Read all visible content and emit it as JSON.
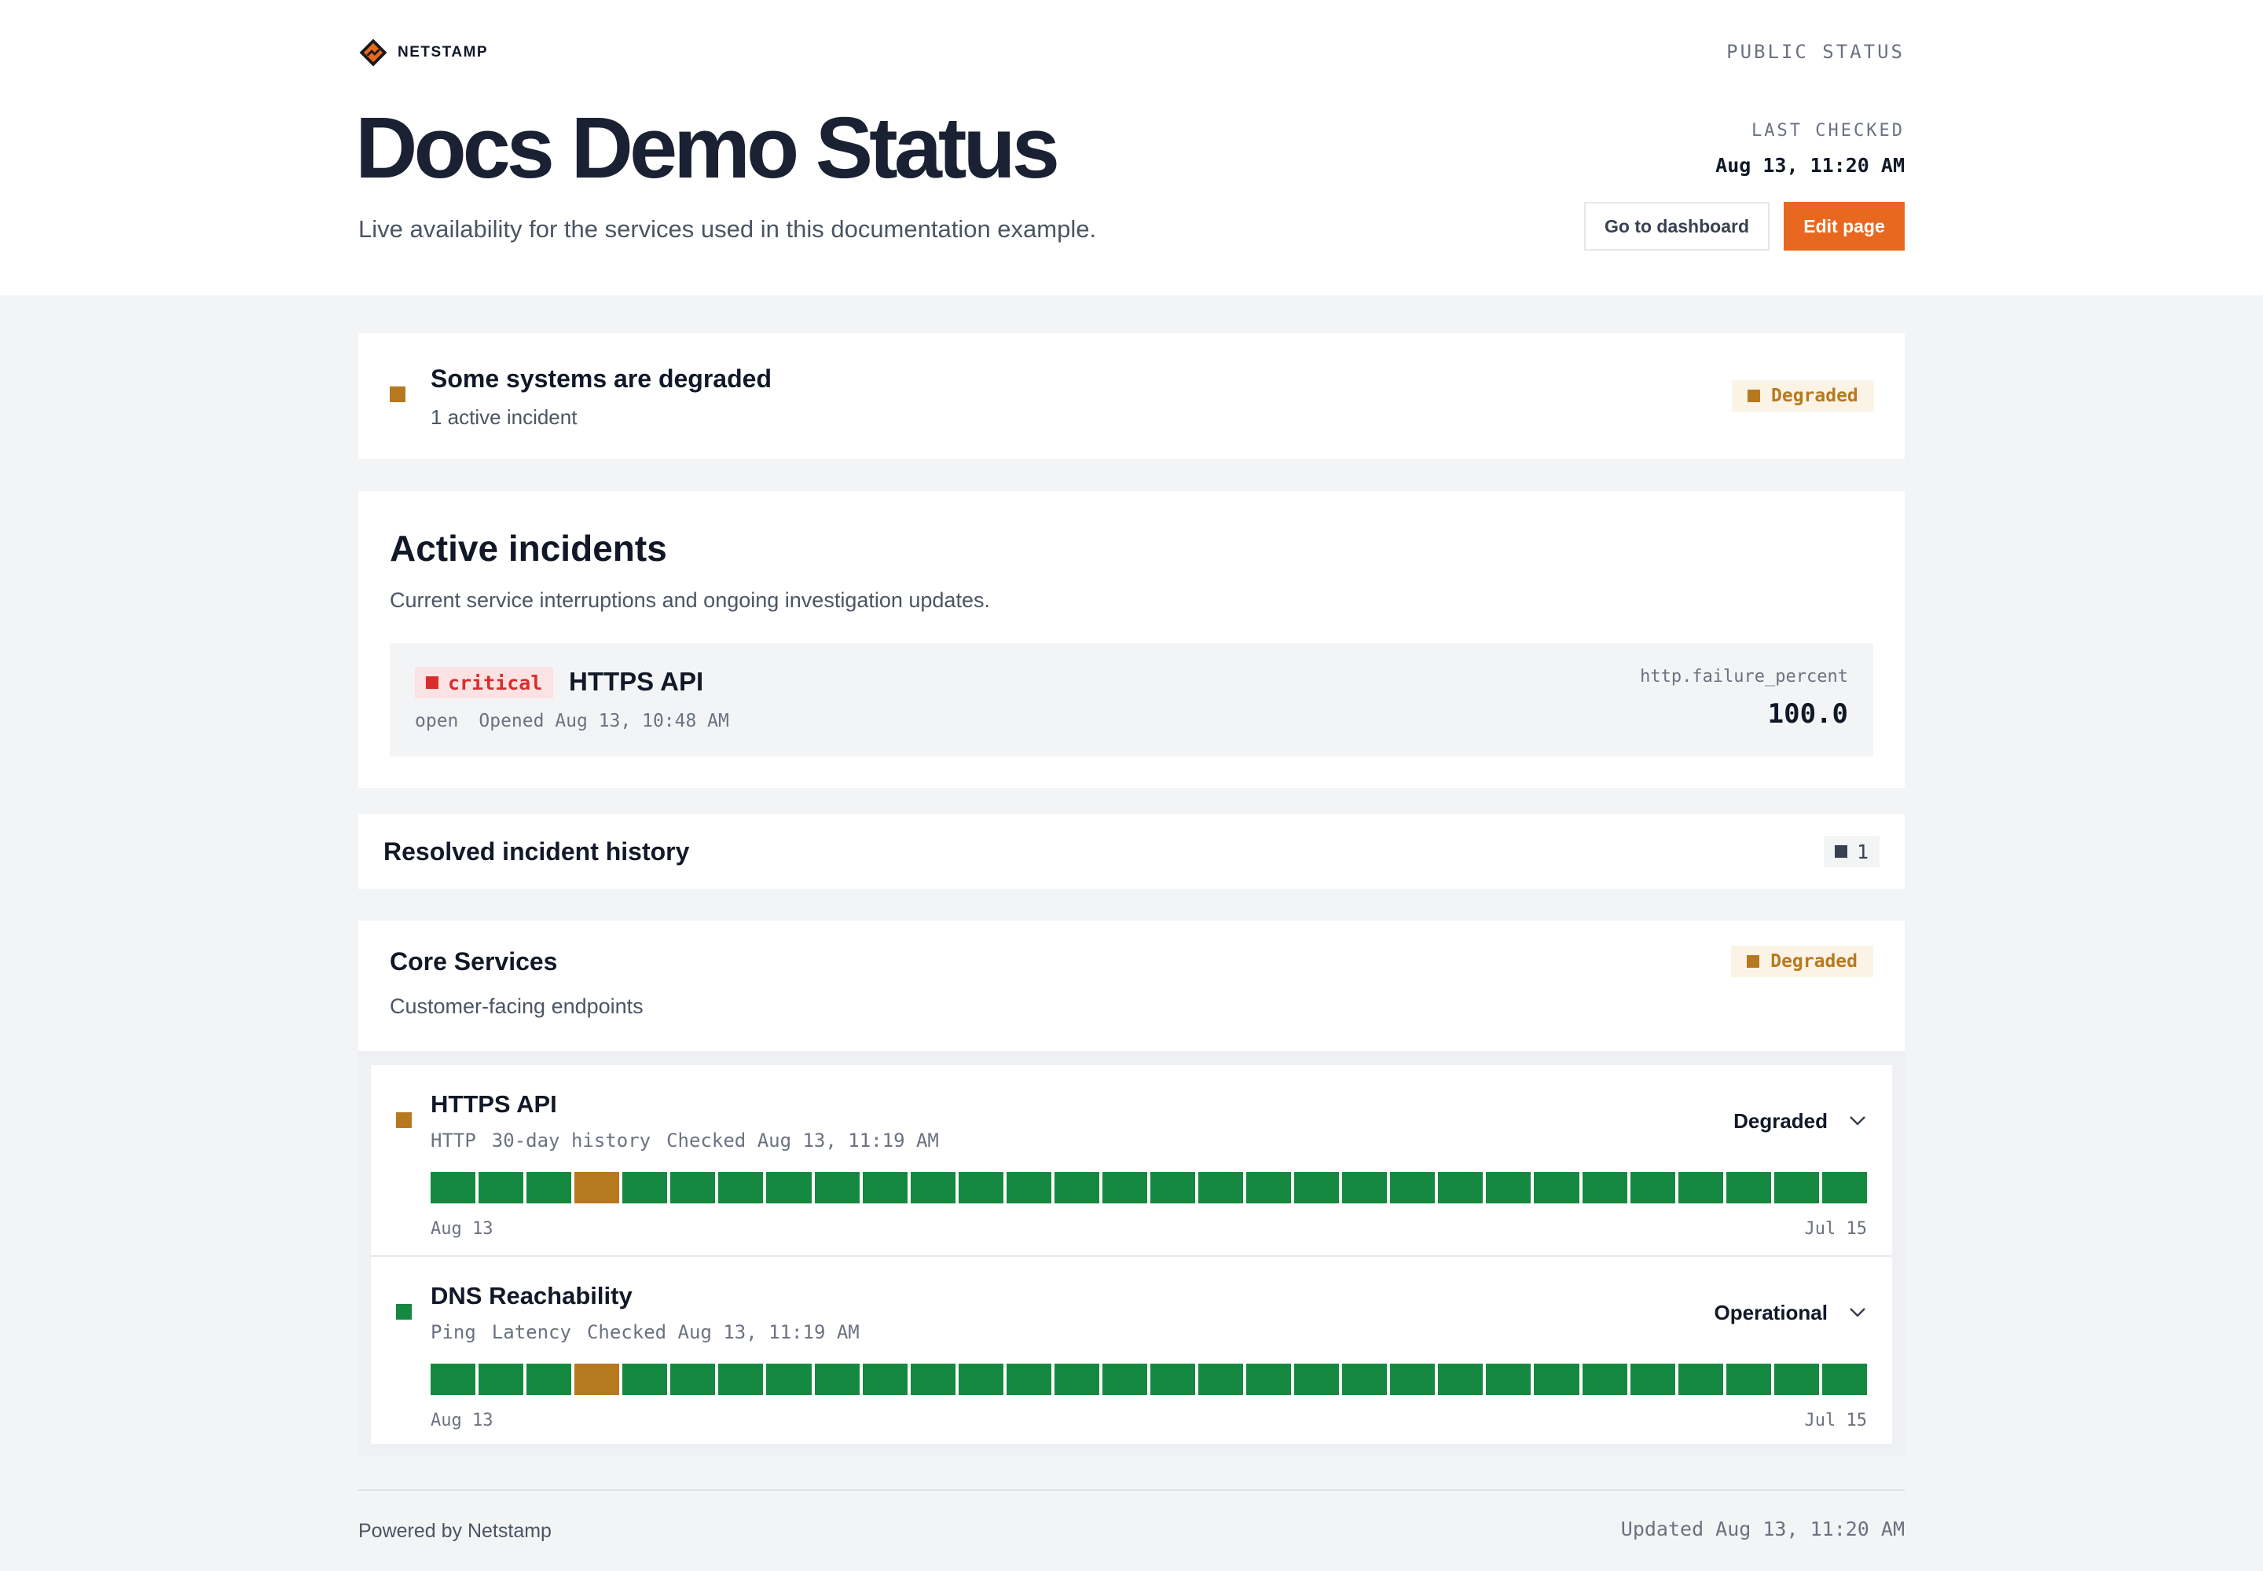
{
  "brand": {
    "name": "NETSTAMP",
    "logo_icon": "netstamp-logo-icon",
    "accent": "#e8681f"
  },
  "header": {
    "public_label": "PUBLIC STATUS",
    "title": "Docs Demo Status",
    "subtitle": "Live availability for the services used in this documentation example.",
    "last_checked_label": "LAST CHECKED",
    "last_checked_value": "Aug 13, 11:20 AM",
    "dashboard_button": "Go to dashboard",
    "edit_button": "Edit page"
  },
  "summary": {
    "heading": "Some systems are degraded",
    "subtext": "1 active incident",
    "badge": "Degraded",
    "color": "#b7791f"
  },
  "incidents": {
    "heading": "Active incidents",
    "subtext": "Current service interruptions and ongoing investigation updates.",
    "items": [
      {
        "severity": "critical",
        "name": "HTTPS API",
        "status": "open",
        "opened": "Opened Aug 13, 10:48 AM",
        "metric": "http.failure_percent",
        "value": "100.0",
        "severity_color": "#d92d2d"
      }
    ]
  },
  "resolved": {
    "heading": "Resolved incident history",
    "count": "1"
  },
  "group": {
    "name": "Core Services",
    "description": "Customer-facing endpoints",
    "badge": "Degraded",
    "services": [
      {
        "name": "HTTPS API",
        "type": "HTTP",
        "history": "30-day history",
        "checked": "Checked Aug 13, 11:19 AM",
        "state": "Degraded",
        "state_color": "#b7791f",
        "date_start": "Aug 13",
        "date_end": "Jul 15",
        "days": [
          "up",
          "up",
          "up",
          "degraded",
          "up",
          "up",
          "up",
          "up",
          "up",
          "up",
          "up",
          "up",
          "up",
          "up",
          "up",
          "up",
          "up",
          "up",
          "up",
          "up",
          "up",
          "up",
          "up",
          "up",
          "up",
          "up",
          "up",
          "up",
          "up",
          "up"
        ]
      },
      {
        "name": "DNS Reachability",
        "type": "Ping",
        "history": "Latency",
        "checked": "Checked Aug 13, 11:19 AM",
        "state": "Operational",
        "state_color": "#15893f",
        "date_start": "Aug 13",
        "date_end": "Jul 15",
        "days": [
          "up",
          "up",
          "up",
          "degraded",
          "up",
          "up",
          "up",
          "up",
          "up",
          "up",
          "up",
          "up",
          "up",
          "up",
          "up",
          "up",
          "up",
          "up",
          "up",
          "up",
          "up",
          "up",
          "up",
          "up",
          "up",
          "up",
          "up",
          "up",
          "up",
          "up"
        ]
      }
    ]
  },
  "colors": {
    "up": "#15893f",
    "degraded": "#b7791f"
  },
  "footer": {
    "powered_by": "Powered by Netstamp",
    "updated": "Updated Aug 13, 11:20 AM"
  }
}
